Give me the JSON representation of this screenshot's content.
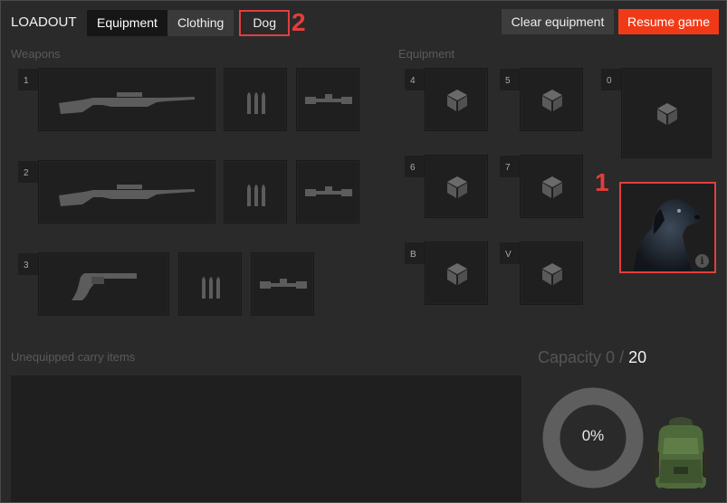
{
  "header": {
    "title": "LOADOUT",
    "tabs": [
      {
        "label": "Equipment",
        "active": true
      },
      {
        "label": "Clothing",
        "active": false
      },
      {
        "label": "Dog",
        "active": false
      }
    ],
    "clear_label": "Clear equipment",
    "resume_label": "Resume game"
  },
  "markers": {
    "dog_tab": "2",
    "dog_slot": "1"
  },
  "weapons": {
    "label": "Weapons",
    "rows": [
      {
        "slot": "1",
        "weapon_icon": "rifle-icon",
        "ammo_icon": "ammo-icon",
        "scope_icon": "scope-icon"
      },
      {
        "slot": "2",
        "weapon_icon": "rifle-icon",
        "ammo_icon": "ammo-icon",
        "scope_icon": "scope-icon"
      },
      {
        "slot": "3",
        "weapon_icon": "revolver-icon",
        "ammo_icon": "ammo-icon",
        "scope_icon": "scope-icon"
      }
    ]
  },
  "equipment": {
    "label": "Equipment",
    "slots": [
      "4",
      "5",
      "0",
      "6",
      "7",
      "B",
      "V"
    ],
    "item_icon": "cube-icon"
  },
  "dog": {
    "icon": "dog-portrait-icon",
    "info_icon": "info-icon"
  },
  "carry": {
    "label": "Unequipped carry items"
  },
  "capacity": {
    "label": "Capacity",
    "current": "0",
    "separator": " / ",
    "max": "20",
    "percent_text": "0%",
    "fill_fraction": 0
  },
  "colors": {
    "accent": "#f03a17",
    "highlight": "#e23d3d",
    "panel": "#1f1f1f",
    "background": "#2a2a2a"
  }
}
